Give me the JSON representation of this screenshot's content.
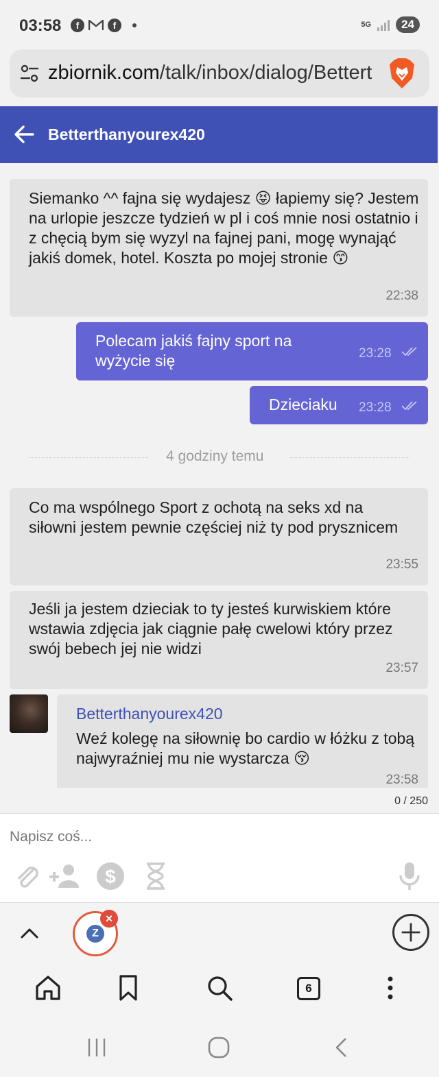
{
  "status_bar": {
    "time": "03:58",
    "network": "5G",
    "battery": "24",
    "left_icons": [
      "facebook-icon",
      "gmail-icon",
      "facebook-icon",
      "dot"
    ]
  },
  "browser": {
    "url_host": "zbiornik.com",
    "url_path": "/talk/inbox/dialog/Bettert",
    "tabs_count": "6"
  },
  "header": {
    "title": "Betterthanyourex420"
  },
  "messages": [
    {
      "direction": "incoming",
      "text": "Siemanko ^^ fajna się wydajesz 😝 łapiemy się? Jestem na urlopie jeszcze tydzień w pl i coś mnie nosi ostatnio i z chęcią bym się wyzyl na fajnej pani, mogę wynająć jakiś domek, hotel. Koszta po mojej stronie 😙",
      "time": "22:38"
    },
    {
      "direction": "outgoing",
      "text": "Polecam jakiś fajny sport na wyżycie się",
      "time": "23:28"
    },
    {
      "direction": "outgoing",
      "text": "Dzieciaku",
      "time": "23:28"
    },
    {
      "direction": "incoming",
      "text": "Co ma wspólnego Sport z ochotą na seks xd na siłowni jestem pewnie częściej niż ty pod prysznicem",
      "time": "23:55"
    },
    {
      "direction": "incoming",
      "text": "Jeśli ja jestem dzieciak to ty jesteś kurwiskiem które wstawia zdjęcia jak ciągnie pałę cwelowi który przez swój bebech jej nie widzi",
      "time": "23:57"
    },
    {
      "direction": "incoming",
      "sender": "Betterthanyourex420",
      "text": "Weź kolegę na siłownię bo cardio w łóżku z tobą najwyraźniej mu nie wystarcza 😚",
      "time": "23:58"
    }
  ],
  "divider_text": "4 godziny temu",
  "composer": {
    "placeholder": "Napisz coś...",
    "counter": "0 / 250"
  },
  "colors": {
    "header_bg": "#3f51b5",
    "outgoing_bg": "#6464d4",
    "incoming_bg": "#e3e3e3",
    "sender_name": "#3f51b5"
  }
}
